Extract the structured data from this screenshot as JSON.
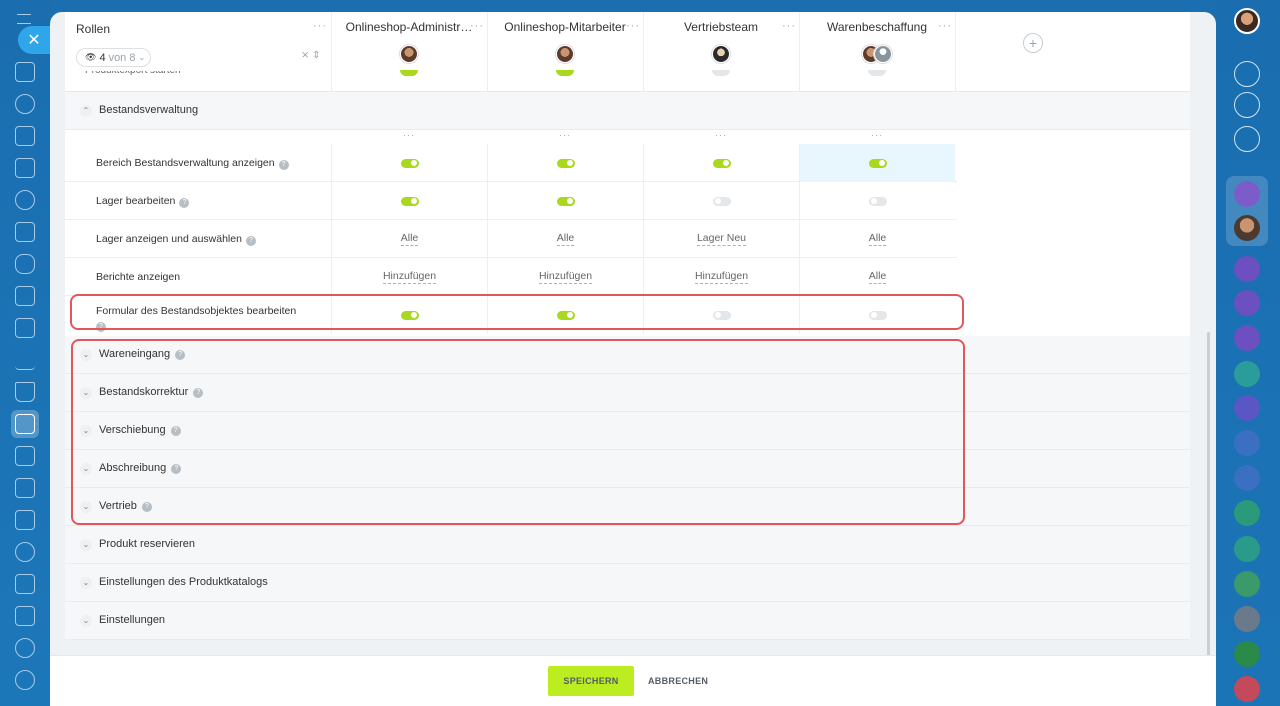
{
  "header": {
    "roles_label": "Rollen",
    "counter_count": "4",
    "counter_rest": "von 8",
    "columns": [
      "Onlineshop-Administr…",
      "Onlineshop-Mitarbeiter",
      "Vertriebsteam",
      "Warenbeschaffung"
    ],
    "peek_label": "Produktexport starten"
  },
  "sections": {
    "stock": "Bestandsverwaltung",
    "goods_receipt": "Wareneingang",
    "stock_correction": "Bestandskorrektur",
    "transfer": "Verschiebung",
    "write_off": "Abschreibung",
    "sales": "Vertrieb",
    "reserve": "Produkt reservieren",
    "catalog_settings": "Einstellungen des Produktkatalogs",
    "settings": "Einstellungen"
  },
  "rows": [
    {
      "label": "Bereich Bestandsverwaltung anzeigen",
      "cells": [
        {
          "toggle": "on"
        },
        {
          "toggle": "on"
        },
        {
          "toggle": "on"
        },
        {
          "toggle": "on"
        }
      ]
    },
    {
      "label": "Lager bearbeiten",
      "cells": [
        {
          "toggle": "on"
        },
        {
          "toggle": "on"
        },
        {
          "toggle": "off"
        },
        {
          "toggle": "off"
        }
      ]
    },
    {
      "label": "Lager anzeigen und auswählen",
      "cells": [
        {
          "text": "Alle"
        },
        {
          "text": "Alle"
        },
        {
          "text": "Lager Neu"
        },
        {
          "text": "Alle"
        }
      ]
    },
    {
      "label": "Berichte anzeigen",
      "cells": [
        {
          "text": "Hinzufügen"
        },
        {
          "text": "Hinzufügen"
        },
        {
          "text": "Hinzufügen"
        },
        {
          "text": "Alle"
        }
      ]
    },
    {
      "label": "Formular des Bestandsobjektes bearbeiten",
      "cells": [
        {
          "toggle": "on"
        },
        {
          "toggle": "on"
        },
        {
          "toggle": "off"
        },
        {
          "toggle": "off"
        }
      ]
    }
  ],
  "footer": {
    "save": "SPEICHERN",
    "cancel": "ABBRECHEN"
  },
  "colors": {
    "toggle_on": "#a8d91f",
    "save_button": "#bbed21",
    "highlight_box": "#e0585c",
    "sidebar": "#1b6fb0"
  },
  "icons": {
    "close": "close-icon",
    "add_column": "plus-icon",
    "help": "help-icon"
  }
}
